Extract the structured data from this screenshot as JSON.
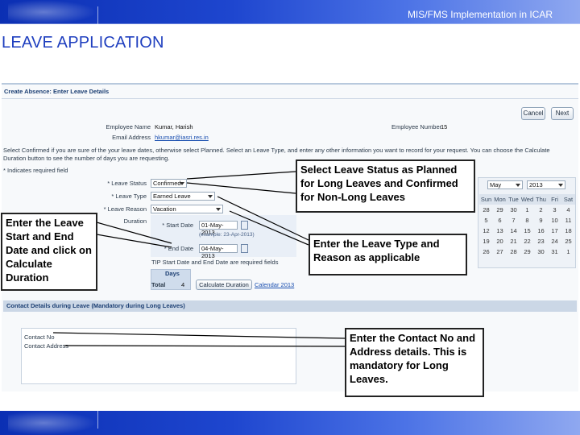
{
  "header": {
    "title": "MIS/FMS Implementation in ICAR"
  },
  "slide": {
    "title": "LEAVE APPLICATION"
  },
  "app": {
    "page_header": "Create Absence: Enter Leave Details",
    "buttons": {
      "cancel": "Cancel",
      "next": "Next"
    },
    "employee_name_label": "Employee Name",
    "employee_name_value": "Kumar, Harish",
    "email_label": "Email Address",
    "email_value": "hkumar@iasri.res.in",
    "employee_number_label": "Employee Number",
    "employee_number_value": "15",
    "instructions": "Select Confirmed if you are sure of the your leave dates, otherwise select Planned. Select an Leave Type, and enter any other information you want to record for your request. You can choose the Calculate Duration button to see the number of days you are requesting.",
    "required_note": "* Indicates required field",
    "leave_status_label": "* Leave Status",
    "leave_status_value": "Confirmed",
    "leave_type_label": "* Leave Type",
    "leave_type_value": "Earned Leave",
    "leave_reason_label": "* Leave Reason",
    "leave_reason_value": "Vacation",
    "duration_label": "Duration",
    "start_date_label": "* Start Date",
    "start_date_value": "01-May-2013",
    "start_date_example": "(example: 23-Apr-2013)",
    "end_date_label": "* End Date",
    "end_date_value": "04-May-2013",
    "tip": "TIP Start Date and End Date are required fields",
    "days_header": "Days",
    "total_label": "Total",
    "total_value": "4",
    "calc_button": "Calculate Duration",
    "calendar_link": "Calendar 2013",
    "calendar": {
      "month": "May",
      "year": "2013",
      "weekdays": [
        "Sun",
        "Mon",
        "Tue",
        "Wed",
        "Thu",
        "Fri",
        "Sat"
      ],
      "weeks": [
        [
          "28",
          "29",
          "30",
          "1",
          "2",
          "3",
          "4"
        ],
        [
          "5",
          "6",
          "7",
          "8",
          "9",
          "10",
          "11"
        ],
        [
          "12",
          "13",
          "14",
          "15",
          "16",
          "17",
          "18"
        ],
        [
          "19",
          "20",
          "21",
          "22",
          "23",
          "24",
          "25"
        ],
        [
          "26",
          "27",
          "28",
          "29",
          "30",
          "31",
          "1"
        ]
      ]
    },
    "contact_section": "Contact Details during Leave (Mandatory during Long Leaves)",
    "contact_no_label": "Contact No",
    "contact_address_label": "Contact Address"
  },
  "callouts": {
    "status": "Select Leave Status as Planned for Long Leaves and Confirmed for Non-Long Leaves",
    "dates": "Enter the Leave Start and End Date and click on Calculate Duration",
    "type": "Enter the Leave Type and Reason as applicable",
    "contact": "Enter the Contact No and Address details. This is mandatory for Long Leaves."
  },
  "colors": {
    "banner": "#1e46cf",
    "title": "#1f3fbf",
    "link": "#1a4fb0"
  }
}
